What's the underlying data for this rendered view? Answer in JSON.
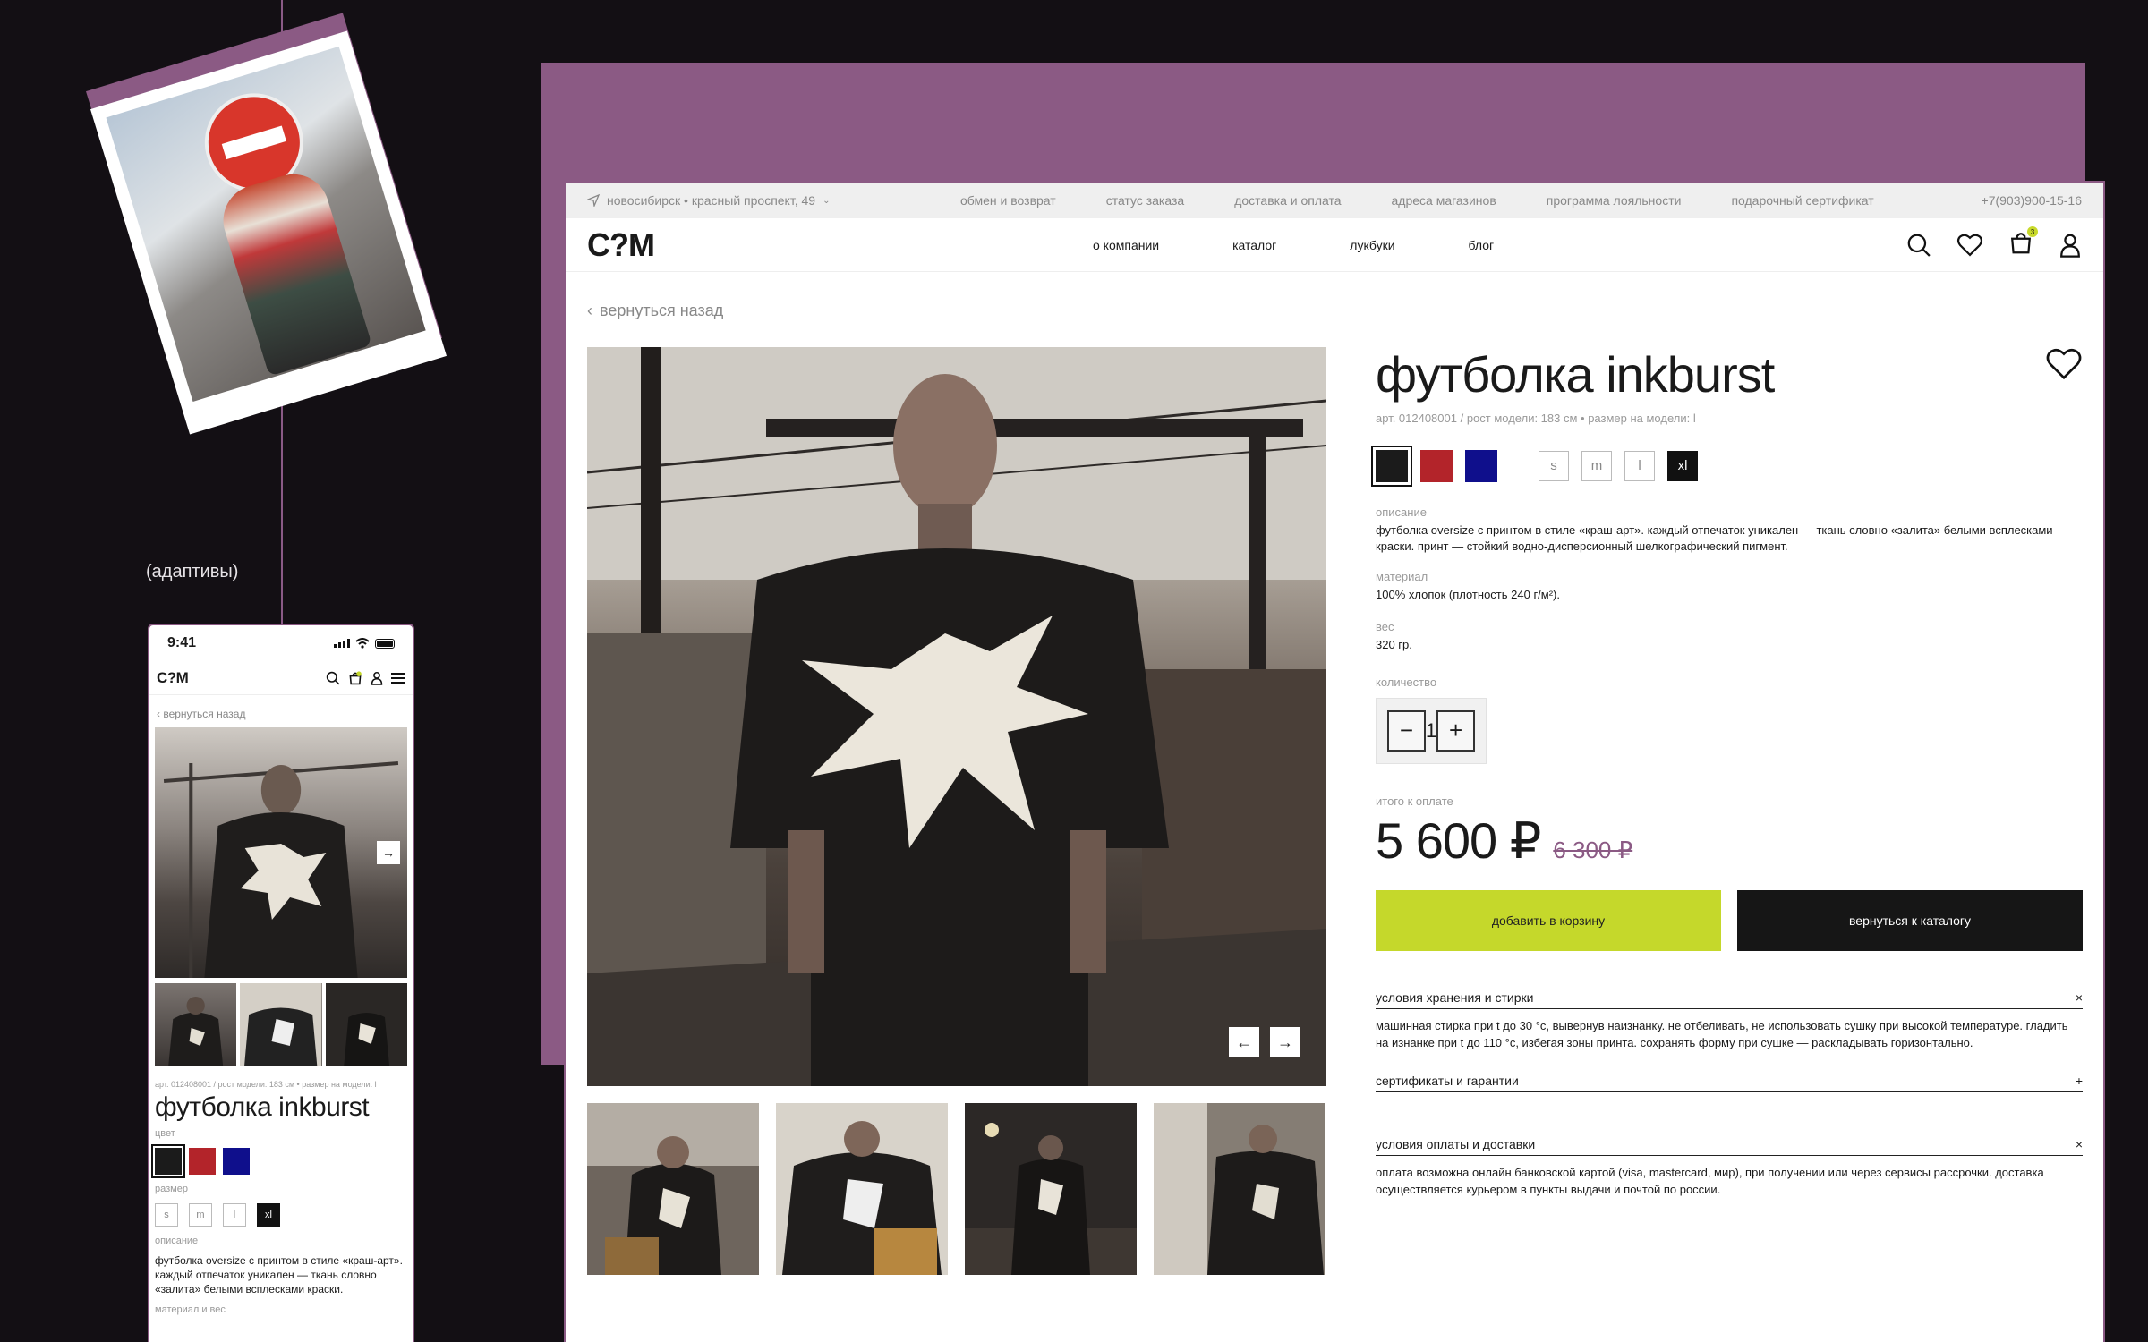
{
  "section_label": "адаптивы",
  "desktop": {
    "topbar": {
      "location": "новосибирск • красный проспект, 49",
      "links": [
        "обмен и возврат",
        "статус заказа",
        "доставка и оплата",
        "адреса магазинов",
        "программа лояльности",
        "подарочный сертификат"
      ],
      "phone": "+7(903)900-15-16"
    },
    "logo": "C?M",
    "nav": [
      "о компании",
      "каталог",
      "лукбуки",
      "блог"
    ],
    "cart_count": "3",
    "back": "вернуться назад",
    "product": {
      "title": "футболка inkburst",
      "meta": "арт. 012408001  /  рост модели: 183 см  •  размер на модели: l",
      "colors": [
        "#1b1b1b",
        "#b3242a",
        "#0f0f8c"
      ],
      "sizes": [
        "s",
        "m",
        "l",
        "xl"
      ],
      "selected_size": "xl",
      "description_label": "описание",
      "description": "футболка oversize с принтом в стиле «краш-арт». каждый отпечаток уникален — ткань словно «залита» белыми всплесками краски. принт — стойкий водно-дисперсионный шелкографический пигмент.",
      "material_label": "материал",
      "material": "100% хлопок (плотность 240 г/м²).",
      "weight_label": "вес",
      "weight": "320 гр.",
      "quantity_label": "количество",
      "quantity": "1",
      "total_label": "итого к оплате",
      "price": "5 600 ₽",
      "old_price": "6 300 ₽",
      "add_to_cart": "добавить в корзину",
      "back_to_catalog": "вернуться к каталогу"
    },
    "accordion": [
      {
        "title": "условия хранения и стирки",
        "icon": "×",
        "body": "машинная стирка при t до 30 °c, вывернув наизнанку. не отбеливать, не использовать сушку при высокой температуре. гладить на изнанке при t до 110 °c, избегая зоны принта. сохранять форму при сушке — раскладывать горизонтально."
      },
      {
        "title": "сертификаты и гарантии",
        "icon": "+",
        "body": ""
      },
      {
        "title": "условия оплаты и доставки",
        "icon": "×",
        "body": "оплата возможна онлайн банковской картой (visa, mastercard, мир), при получении или через сервисы рассрочки. доставка осуществляется курьером в пункты выдачи и почтой по россии."
      }
    ]
  },
  "mobile": {
    "time": "9:41",
    "logo": "C?M",
    "back": "вернуться назад",
    "meta": "арт. 012408001  /  рост модели: 183 см  •  размер на модели: l",
    "title": "футболка inkburst",
    "color_label": "цвет",
    "size_label": "размер",
    "description_label": "описание",
    "description": "футболка oversize с принтом в стиле «краш-арт». каждый отпечаток уникален — ткань словно «залита» белыми всплесками краски.",
    "material_label": "материал и вес"
  }
}
